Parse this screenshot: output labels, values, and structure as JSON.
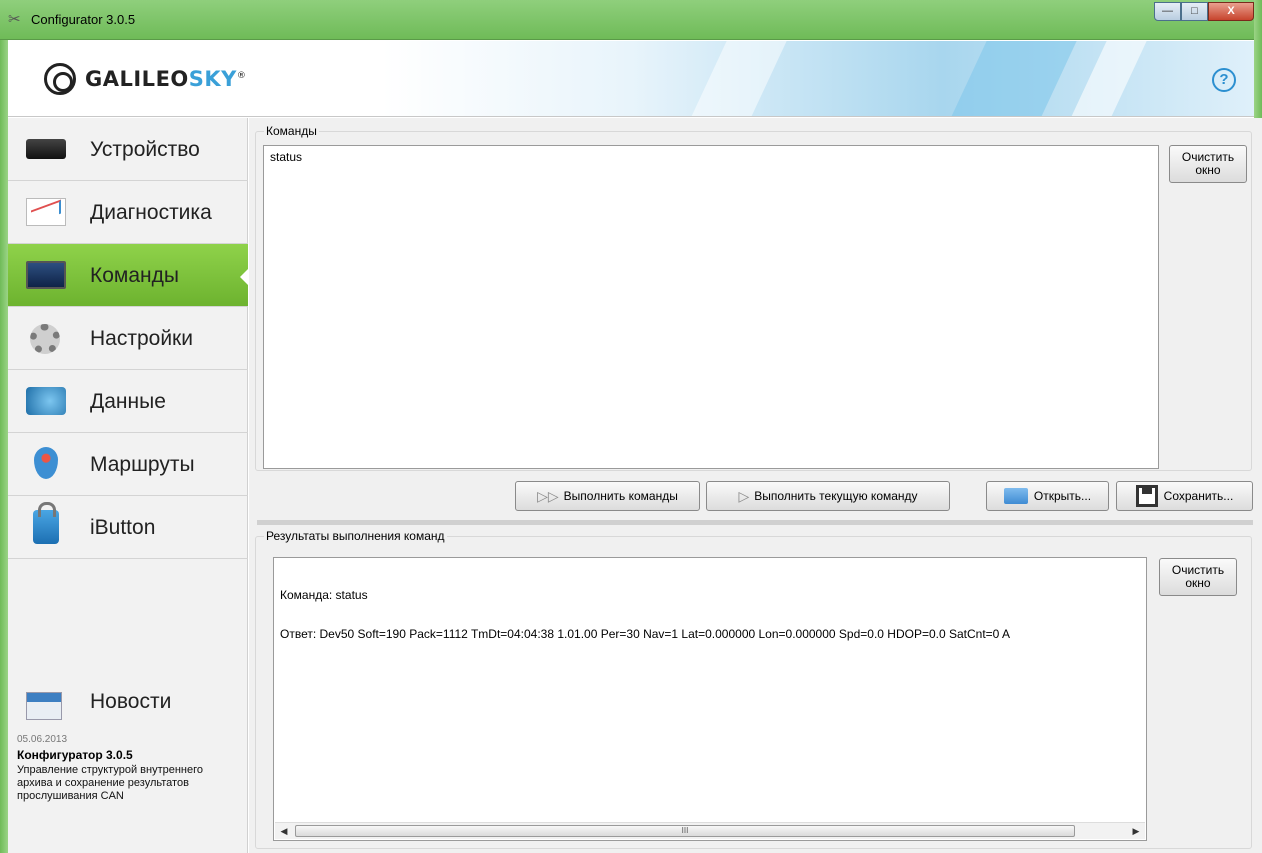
{
  "window": {
    "title": "Configurator 3.0.5",
    "minimize": "—",
    "maximize": "□",
    "close": "X"
  },
  "header": {
    "logo_main": "GALILEO",
    "logo_accent": "SKY",
    "logo_mark": "®",
    "help": "?"
  },
  "sidebar": {
    "items": [
      {
        "label": "Устройство",
        "icon": "device-icon"
      },
      {
        "label": "Диагностика",
        "icon": "diagnostics-icon"
      },
      {
        "label": "Команды",
        "icon": "commands-icon",
        "active": true
      },
      {
        "label": "Настройки",
        "icon": "settings-gear-icon"
      },
      {
        "label": "Данные",
        "icon": "data-icon"
      },
      {
        "label": "Маршруты",
        "icon": "route-pin-icon"
      },
      {
        "label": "iButton",
        "icon": "ibutton-lock-icon"
      }
    ],
    "news": {
      "label": "Новости",
      "date": "05.06.2013",
      "title": "Конфигуратор 3.0.5",
      "text": "Управление структурой внутреннего архива и сохранение результатов прослушивания CAN"
    }
  },
  "commands": {
    "group_title": "Команды",
    "text": "status",
    "clear_line1": "Очистить",
    "clear_line2": "окно",
    "run_all": "Выполнить команды",
    "run_current": "Выполнить текущую команду",
    "open": "Открыть...",
    "save": "Сохранить..."
  },
  "results": {
    "group_title": "Результаты выполнения команд",
    "line1": "Команда: status",
    "line2": "Ответ: Dev50 Soft=190 Pack=1112 TmDt=04:04:38 1.01.00 Per=30 Nav=1 Lat=0.000000 Lon=0.000000 Spd=0.0 HDOP=0.0 SatCnt=0 A",
    "clear_line1": "Очистить",
    "clear_line2": "окно",
    "scroll_grip": "III"
  },
  "colors": {
    "accent_green": "#7cc03c",
    "brand_blue": "#3aa0d8",
    "titlebar_green": "#7fc46a"
  }
}
